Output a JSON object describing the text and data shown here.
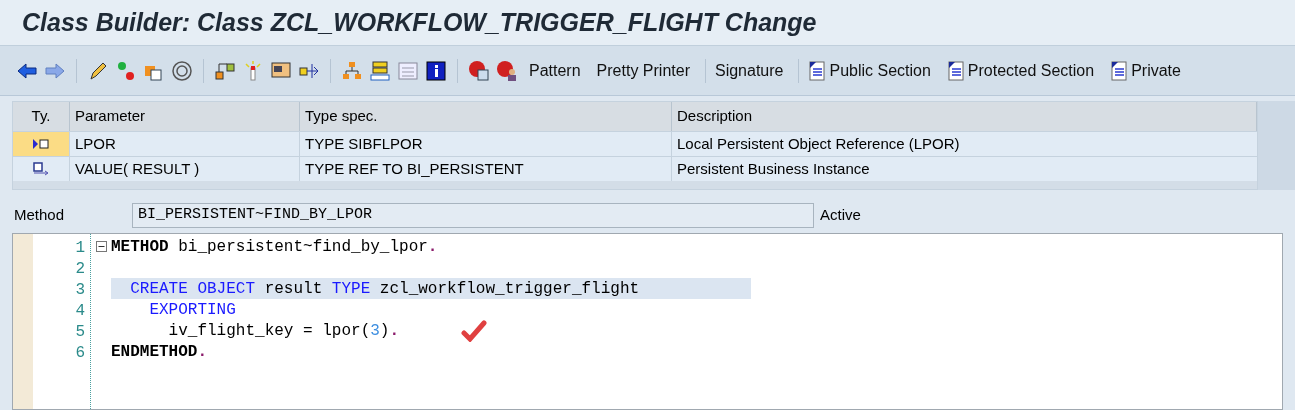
{
  "window": {
    "title": "Class Builder: Class ZCL_WORKFLOW_TRIGGER_FLIGHT Change"
  },
  "toolbar": {
    "buttons": [
      {
        "kind": "text",
        "label": "Pattern"
      },
      {
        "kind": "text",
        "label": "Pretty Printer"
      },
      {
        "kind": "text",
        "label": "Signature"
      },
      {
        "kind": "section",
        "label": "Public Section"
      },
      {
        "kind": "section",
        "label": "Protected Section"
      },
      {
        "kind": "section",
        "label": "Private"
      }
    ]
  },
  "parameters": {
    "columns": [
      "Ty.",
      "Parameter",
      "Type spec.",
      "Description"
    ],
    "rows": [
      {
        "kind": "importing",
        "selected": true,
        "parameter": "LPOR",
        "type_spec": "TYPE SIBFLPOR",
        "description": "Local Persistent Object Reference (LPOR)"
      },
      {
        "kind": "returning",
        "selected": false,
        "parameter": "VALUE( RESULT )",
        "type_spec": "TYPE REF TO BI_PERSISTENT",
        "description": "Persistent Business Instance"
      }
    ]
  },
  "method": {
    "label": "Method",
    "value": "BI_PERSISTENT~FIND_BY_LPOR",
    "status": "Active"
  },
  "editor": {
    "lines": [
      {
        "number": "1",
        "current": false,
        "fold": true,
        "tokens": [
          {
            "kind": "keyword",
            "text": "METHOD"
          },
          {
            "kind": "plain",
            "text": " bi_persistent~find_by_lpor"
          },
          {
            "kind": "punct",
            "text": "."
          }
        ]
      },
      {
        "number": "2",
        "current": false,
        "fold": false
      },
      {
        "number": "3",
        "current": true,
        "fold": false,
        "tokens": [
          {
            "kind": "statement",
            "text": "  CREATE OBJECT"
          },
          {
            "kind": "plain",
            "text": " result "
          },
          {
            "kind": "statement",
            "text": "TYPE"
          },
          {
            "kind": "plain",
            "text": " zcl_workflow_trigger_flight"
          }
        ]
      },
      {
        "number": "4",
        "current": false,
        "fold": false,
        "tokens": [
          {
            "kind": "statement",
            "text": "    EXPORTING"
          }
        ]
      },
      {
        "number": "5",
        "current": false,
        "fold": false,
        "mark": true,
        "tokens": [
          {
            "kind": "plain",
            "text": "      iv_flight_key = lpor("
          },
          {
            "kind": "number",
            "text": "3"
          },
          {
            "kind": "plain",
            "text": ")"
          },
          {
            "kind": "punct",
            "text": "."
          }
        ]
      },
      {
        "number": "6",
        "current": false,
        "fold": false,
        "tokens": [
          {
            "kind": "keyword",
            "text": "ENDMETHOD"
          },
          {
            "kind": "punct",
            "text": "."
          }
        ]
      }
    ]
  }
}
